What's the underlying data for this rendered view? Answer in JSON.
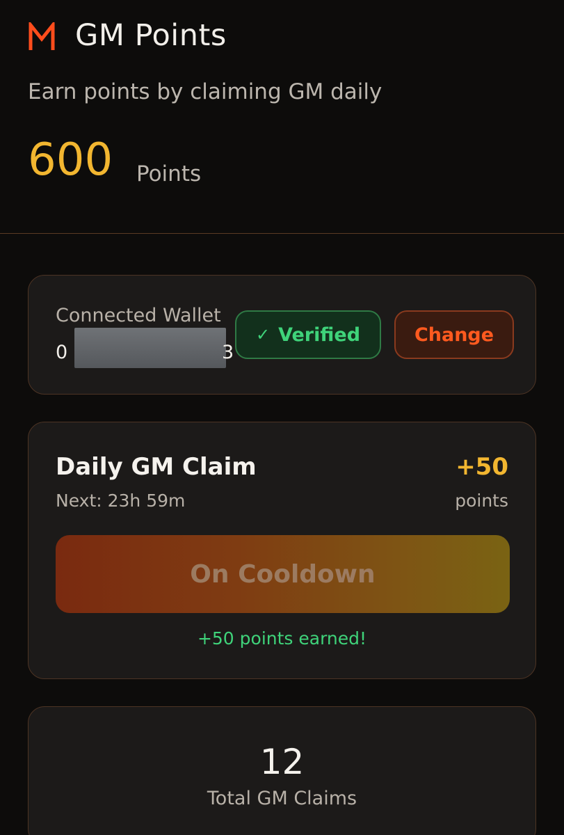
{
  "header": {
    "title": "GM Points",
    "subtitle": "Earn points by claiming GM daily",
    "points_value": "600",
    "points_unit": "Points",
    "logo_icon": "m-logo-icon"
  },
  "wallet": {
    "label": "Connected Wallet",
    "address_start": "0",
    "address_end": "3",
    "verified_label": "Verified",
    "verified_icon": "check-icon",
    "change_label": "Change"
  },
  "claim": {
    "title": "Daily GM Claim",
    "next": "Next: 23h 59m",
    "reward_value": "+50",
    "reward_unit": "points",
    "button_label": "On Cooldown",
    "earned_message": "+50 points earned!"
  },
  "total": {
    "value": "12",
    "label": "Total GM Claims"
  },
  "colors": {
    "accent_gold": "#f2b630",
    "accent_orange": "#ff5a1f",
    "success_green": "#3fd37a",
    "card_border": "#4d3424"
  }
}
